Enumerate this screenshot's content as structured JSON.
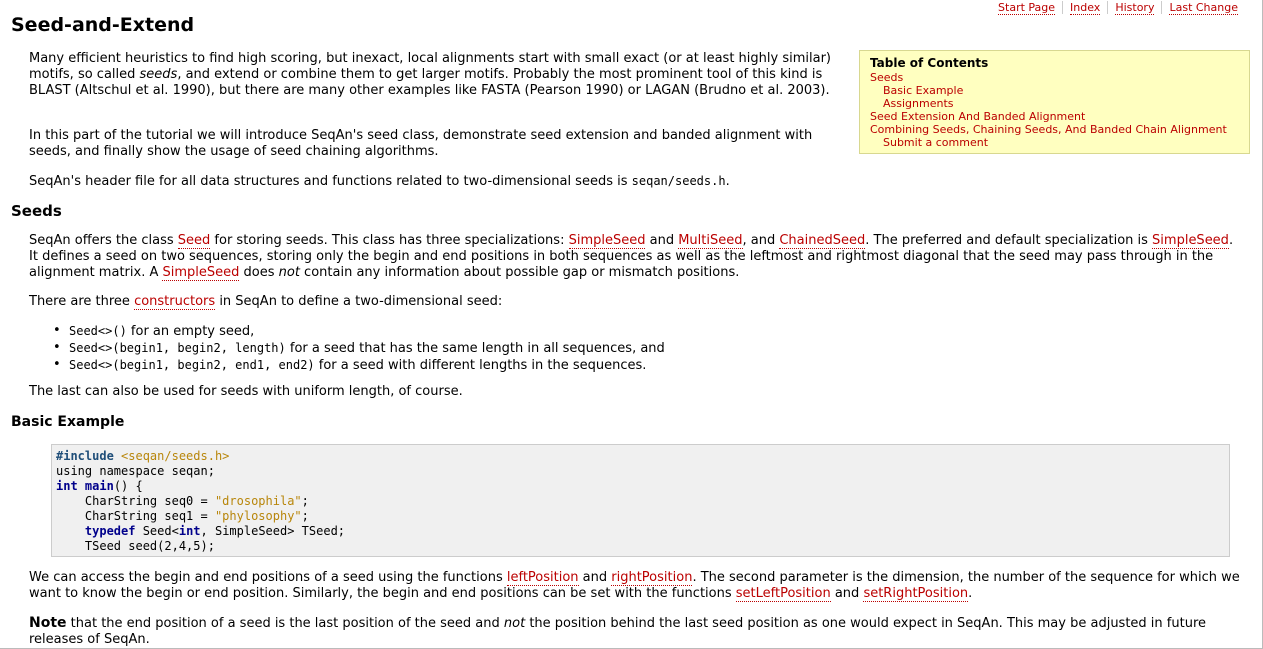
{
  "nav": {
    "start_page": "Start Page",
    "index": "Index",
    "history": "History",
    "last_change": "Last Change"
  },
  "title": "Seed-and-Extend",
  "intro": {
    "p1": {
      "a": "Many efficient heuristics to find high scoring, but inexact, local alignments start with small exact (or at least highly similar) motifs, so called ",
      "em": "seeds",
      "b": ", and extend or combine them to get larger motifs. Probably the most prominent tool of this kind is BLAST (Altschul et al. 1990), but there are many other examples like FASTA (Pearson 1990) or LAGAN (Brudno et al. 2003)."
    },
    "p2": "In this part of the tutorial we will introduce SeqAn's seed class, demonstrate seed extension and banded alignment with seeds, and finally show the usage of seed chaining algorithms.",
    "p3": {
      "a": "SeqAn's header file for all data structures and functions related to two-dimensional seeds is ",
      "code": "seqan/seeds.h",
      "b": "."
    }
  },
  "toc": {
    "title": "Table of Contents",
    "items": [
      {
        "label": "Seeds",
        "level": 1
      },
      {
        "label": "Basic Example",
        "level": 2
      },
      {
        "label": "Assignments",
        "level": 2
      },
      {
        "label": "Seed Extension And Banded Alignment",
        "level": 1
      },
      {
        "label": "Combining Seeds, Chaining Seeds, And Banded Chain Alignment",
        "level": 1
      },
      {
        "label": "Submit a comment",
        "level": 2
      }
    ]
  },
  "seeds": {
    "heading": "Seeds",
    "p1": {
      "t1": "SeqAn offers the class ",
      "l1": "Seed",
      "t2": " for storing seeds. This class has three specializations: ",
      "l2": "SimpleSeed",
      "t3": " and ",
      "l3": "MultiSeed",
      "t4": ", and ",
      "l4": "ChainedSeed",
      "t5": ". The preferred and default specialization is ",
      "l5": "SimpleSeed",
      "t6": ". It defines a seed on two sequences, storing only the begin and end positions in both sequences as well as the leftmost and rightmost diagonal that the seed may pass through in the alignment matrix. A ",
      "l6": "SimpleSeed",
      "t7": " does ",
      "em": "not",
      "t8": " contain any information about possible gap or mismatch positions."
    },
    "p2": {
      "t1": "There are three ",
      "l1": "constructors",
      "t2": " in SeqAn to define a two-dimensional seed:"
    },
    "list": [
      {
        "code": "Seed<>()",
        "text": " for an empty seed,"
      },
      {
        "code": "Seed<>(begin1, begin2, length)",
        "text": " for a seed that has the same length in all sequences, and"
      },
      {
        "code": "Seed<>(begin1, begin2, end1, end2)",
        "text": " for a seed with different lengths in the sequences."
      }
    ],
    "p3": "The last can also be used for seeds with uniform length, of course."
  },
  "basic_example": {
    "heading": "Basic Example",
    "code": {
      "include_kw": "#include",
      "include_path": " <seqan/seeds.h>",
      "line2": "using namespace seqan;",
      "int_kw": "int",
      "main_fn": "main",
      "main_rest": "() {",
      "l4a": "    CharString seq0 = ",
      "l4s": "\"drosophila\"",
      "l4b": ";",
      "l5a": "    CharString seq1 = ",
      "l5s": "\"phylosophy\"",
      "l5b": ";",
      "l6kw": "typedef",
      "l6a": " Seed<",
      "l6int": "int",
      "l6b": ", SimpleSeed> TSeed;",
      "l7": "    TSeed seed(2,4,5);"
    },
    "p1": {
      "t1": "We can access the begin and end positions of a seed using the functions ",
      "l1": "leftPosition",
      "t2": " and ",
      "l2": "rightPosition",
      "t3": ". The second parameter is the dimension, the number of the sequence for which we want to know the begin or end position. Similarly, the begin and end positions can be set with the functions ",
      "l3": "setLeftPosition",
      "t4": " and ",
      "l4": "setRightPosition",
      "t5": "."
    },
    "note": {
      "strong": "Note",
      "t1": " that the end position of a seed is the last position of the seed and ",
      "em": "not",
      "t2": " the position behind the last seed position as one would expect in SeqAn. This may be adjusted in future releases of SeqAn."
    }
  }
}
